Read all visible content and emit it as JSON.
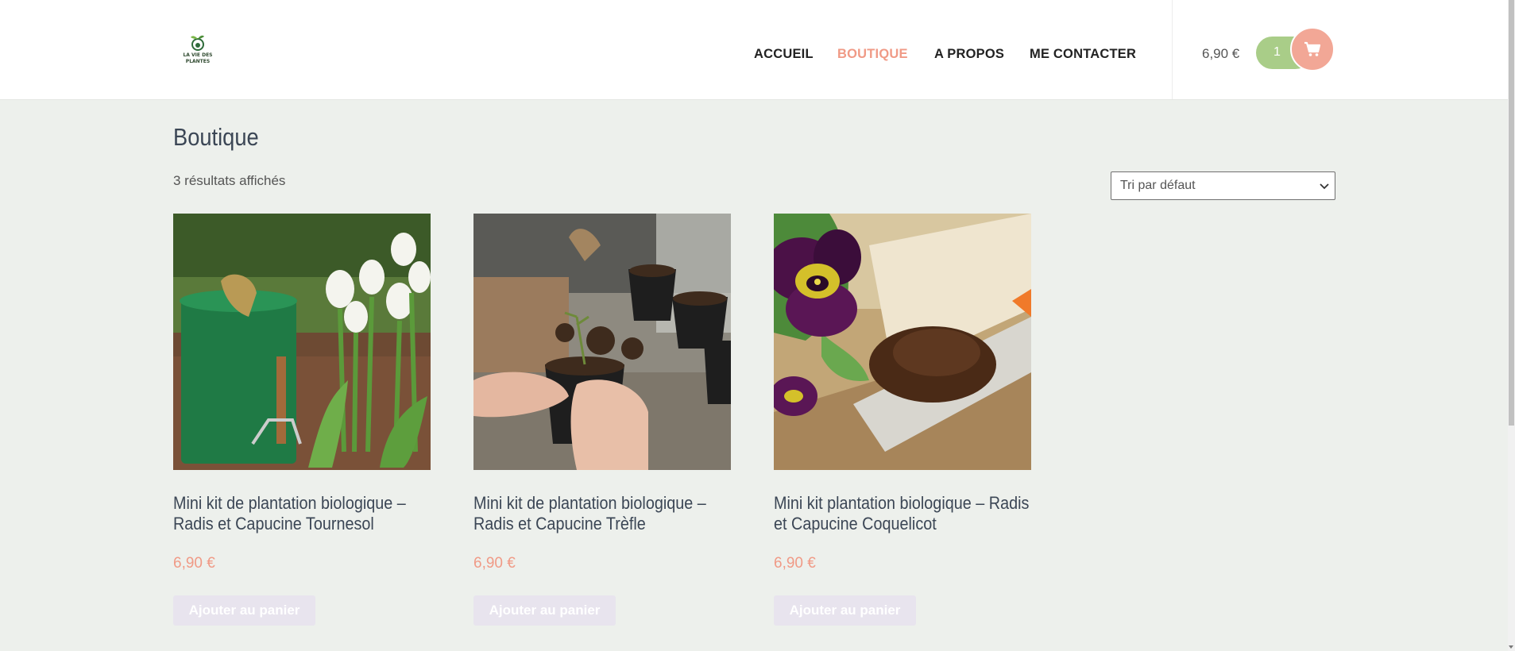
{
  "header": {
    "logo_text": "LA VIE DES PLANTES",
    "nav": [
      {
        "label": "ACCUEIL",
        "active": false
      },
      {
        "label": "BOUTIQUE",
        "active": true
      },
      {
        "label": "A PROPOS",
        "active": false
      },
      {
        "label": "ME CONTACTER",
        "active": false
      }
    ],
    "cart_total": "6,90 €",
    "cart_count": "1"
  },
  "main": {
    "title": "Boutique",
    "result_count": "3 résultats affichés",
    "sort": {
      "selected": "Tri par défaut"
    },
    "products": [
      {
        "name": "Mini kit de plantation biologique – Radis et Capucine Tournesol",
        "price": "6,90 €",
        "button": "Ajouter au panier",
        "image": "green bucket with gloves and white tulips"
      },
      {
        "name": "Mini kit de plantation biologique – Radis et Capucine Trèfle",
        "price": "6,90 €",
        "button": "Ajouter au panier",
        "image": "hands potting seedlings in black pots"
      },
      {
        "name": "Mini kit plantation biologique – Radis et Capucine Coquelicot",
        "price": "6,90 €",
        "button": "Ajouter au panier",
        "image": "purple and yellow pansy beside soil on trowel"
      }
    ]
  },
  "colors": {
    "accent": "#f09a86",
    "cart_badge": "#a9cd88",
    "background": "#edf0ec",
    "button_bg": "#e8e4ee"
  }
}
